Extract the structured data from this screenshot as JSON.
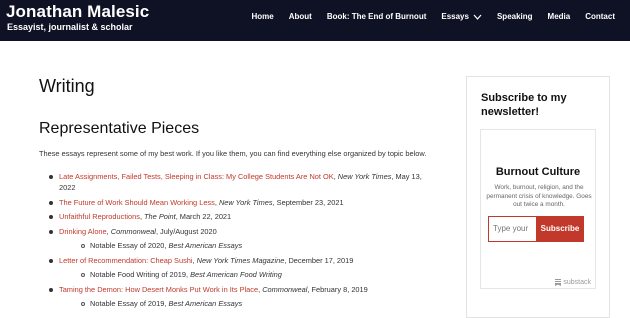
{
  "header": {
    "title": "Jonathan Malesic",
    "tagline": "Essayist, journalist & scholar",
    "nav": [
      "Home",
      "About",
      "Book: The End of Burnout",
      "Essays",
      "Speaking",
      "Media",
      "Contact"
    ]
  },
  "main": {
    "page_title": "Writing",
    "section_title": "Representative Pieces",
    "intro": "These essays represent some of my best work. If you like them, you can find everything else organized by topic below.",
    "essays": [
      {
        "link": "Late Assignments, Failed Tests, Sleeping in Class: My College Students Are Not OK",
        "sep": ", ",
        "pub": "New York Times",
        "date": ", May 13, 2022",
        "sub": null
      },
      {
        "link": "The Future of Work Should Mean Working Less",
        "sep": ", ",
        "pub": "New York Times",
        "date": ", September 23, 2021",
        "sub": null
      },
      {
        "link": "Unfaithful Reproductions",
        "sep": ", ",
        "pub": "The Point",
        "date": ", March 22, 2021",
        "sub": null
      },
      {
        "link": "Drinking Alone",
        "sep": ", ",
        "pub": "Commonweal",
        "date": ", July/August 2020",
        "sub": {
          "text": "Notable Essay of 2020, ",
          "italic": "Best American Essays"
        }
      },
      {
        "link": "Letter of Recommendation: Cheap Sushi",
        "sep": ", ",
        "pub": "New York Times Magazine",
        "date": ", December 17, 2019",
        "sub": {
          "text": "Notable Food Writing of 2019, ",
          "italic": "Best American Food Writing"
        }
      },
      {
        "link": "Taming the Demon: How Desert Monks Put Work in Its Place",
        "sep": ", ",
        "pub": "Commonweal",
        "date": ", February 8, 2019",
        "sub": {
          "text": "Notable Essay of 2019, ",
          "italic": "Best American Essays"
        }
      }
    ]
  },
  "sidebar": {
    "title": "Subscribe to my newsletter!",
    "widget_name": "Burnout Culture",
    "widget_desc": "Work, burnout, religion, and the permanent crisis of knowledge. Goes out twice a month.",
    "input_placeholder": "Type your",
    "button_label": "Subscribe",
    "badge": "substack"
  },
  "colors": {
    "header_bg": "#0f1124",
    "link": "#c0392b",
    "accent": "#c0392b"
  }
}
